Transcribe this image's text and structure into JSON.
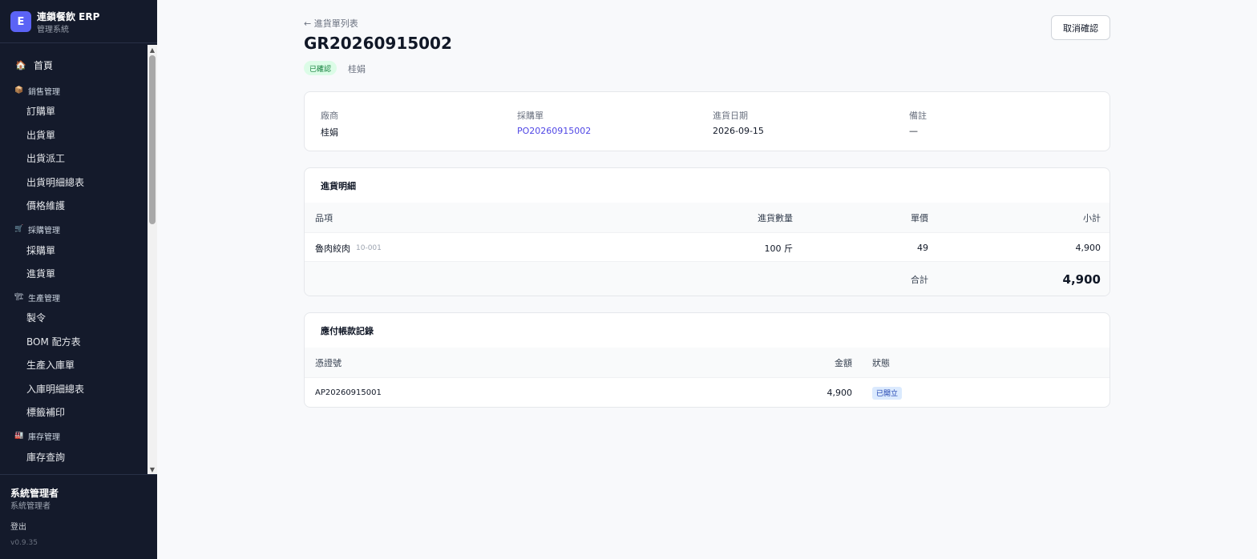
{
  "brand": {
    "logo": "E",
    "title": "連鎖餐飲 ERP",
    "subtitle": "管理系統"
  },
  "nav": {
    "home": {
      "icon": "🏠",
      "label": "首頁"
    },
    "sales": {
      "icon": "📦",
      "label": "銷售管理",
      "items": [
        "訂購單",
        "出貨單",
        "出貨派工",
        "出貨明細總表",
        "價格維護"
      ]
    },
    "purchase": {
      "icon": "🛒",
      "label": "採購管理",
      "items": [
        "採購單",
        "進貨單"
      ]
    },
    "production": {
      "icon": "🏗",
      "label": "生產管理",
      "items": [
        "製令",
        "BOM 配方表",
        "生產入庫單",
        "入庫明細總表",
        "標籤補印"
      ]
    },
    "inventory": {
      "icon": "🏭",
      "label": "庫存管理",
      "items": [
        "庫存查詢"
      ]
    }
  },
  "user": {
    "name": "系統管理者",
    "role": "系統管理者",
    "logout": "登出",
    "version": "v0.9.35"
  },
  "header": {
    "back": "← 進貨單列表",
    "title": "GR20260915002",
    "status": "已確認",
    "vendor": "桂娟",
    "cancel_button": "取消確認"
  },
  "info": {
    "vendor_label": "廠商",
    "vendor_value": "桂娟",
    "po_label": "採購單",
    "po_value": "PO20260915002",
    "date_label": "進貨日期",
    "date_value": "2026-09-15",
    "note_label": "備註",
    "note_value": "—"
  },
  "items": {
    "title": "進貨明細",
    "headers": {
      "item": "品項",
      "qty": "進貨數量",
      "price": "單價",
      "subtotal": "小計"
    },
    "rows": [
      {
        "name": "魯肉絞肉",
        "code": "10-001",
        "qty": "100 斤",
        "price": "49",
        "subtotal": "4,900"
      }
    ],
    "total_label": "合計",
    "total_value": "4,900"
  },
  "ap": {
    "title": "應付帳款記錄",
    "headers": {
      "voucher": "憑證號",
      "amount": "金額",
      "status": "狀態"
    },
    "rows": [
      {
        "voucher": "AP20260915001",
        "amount": "4,900",
        "status": "已開立"
      }
    ]
  }
}
